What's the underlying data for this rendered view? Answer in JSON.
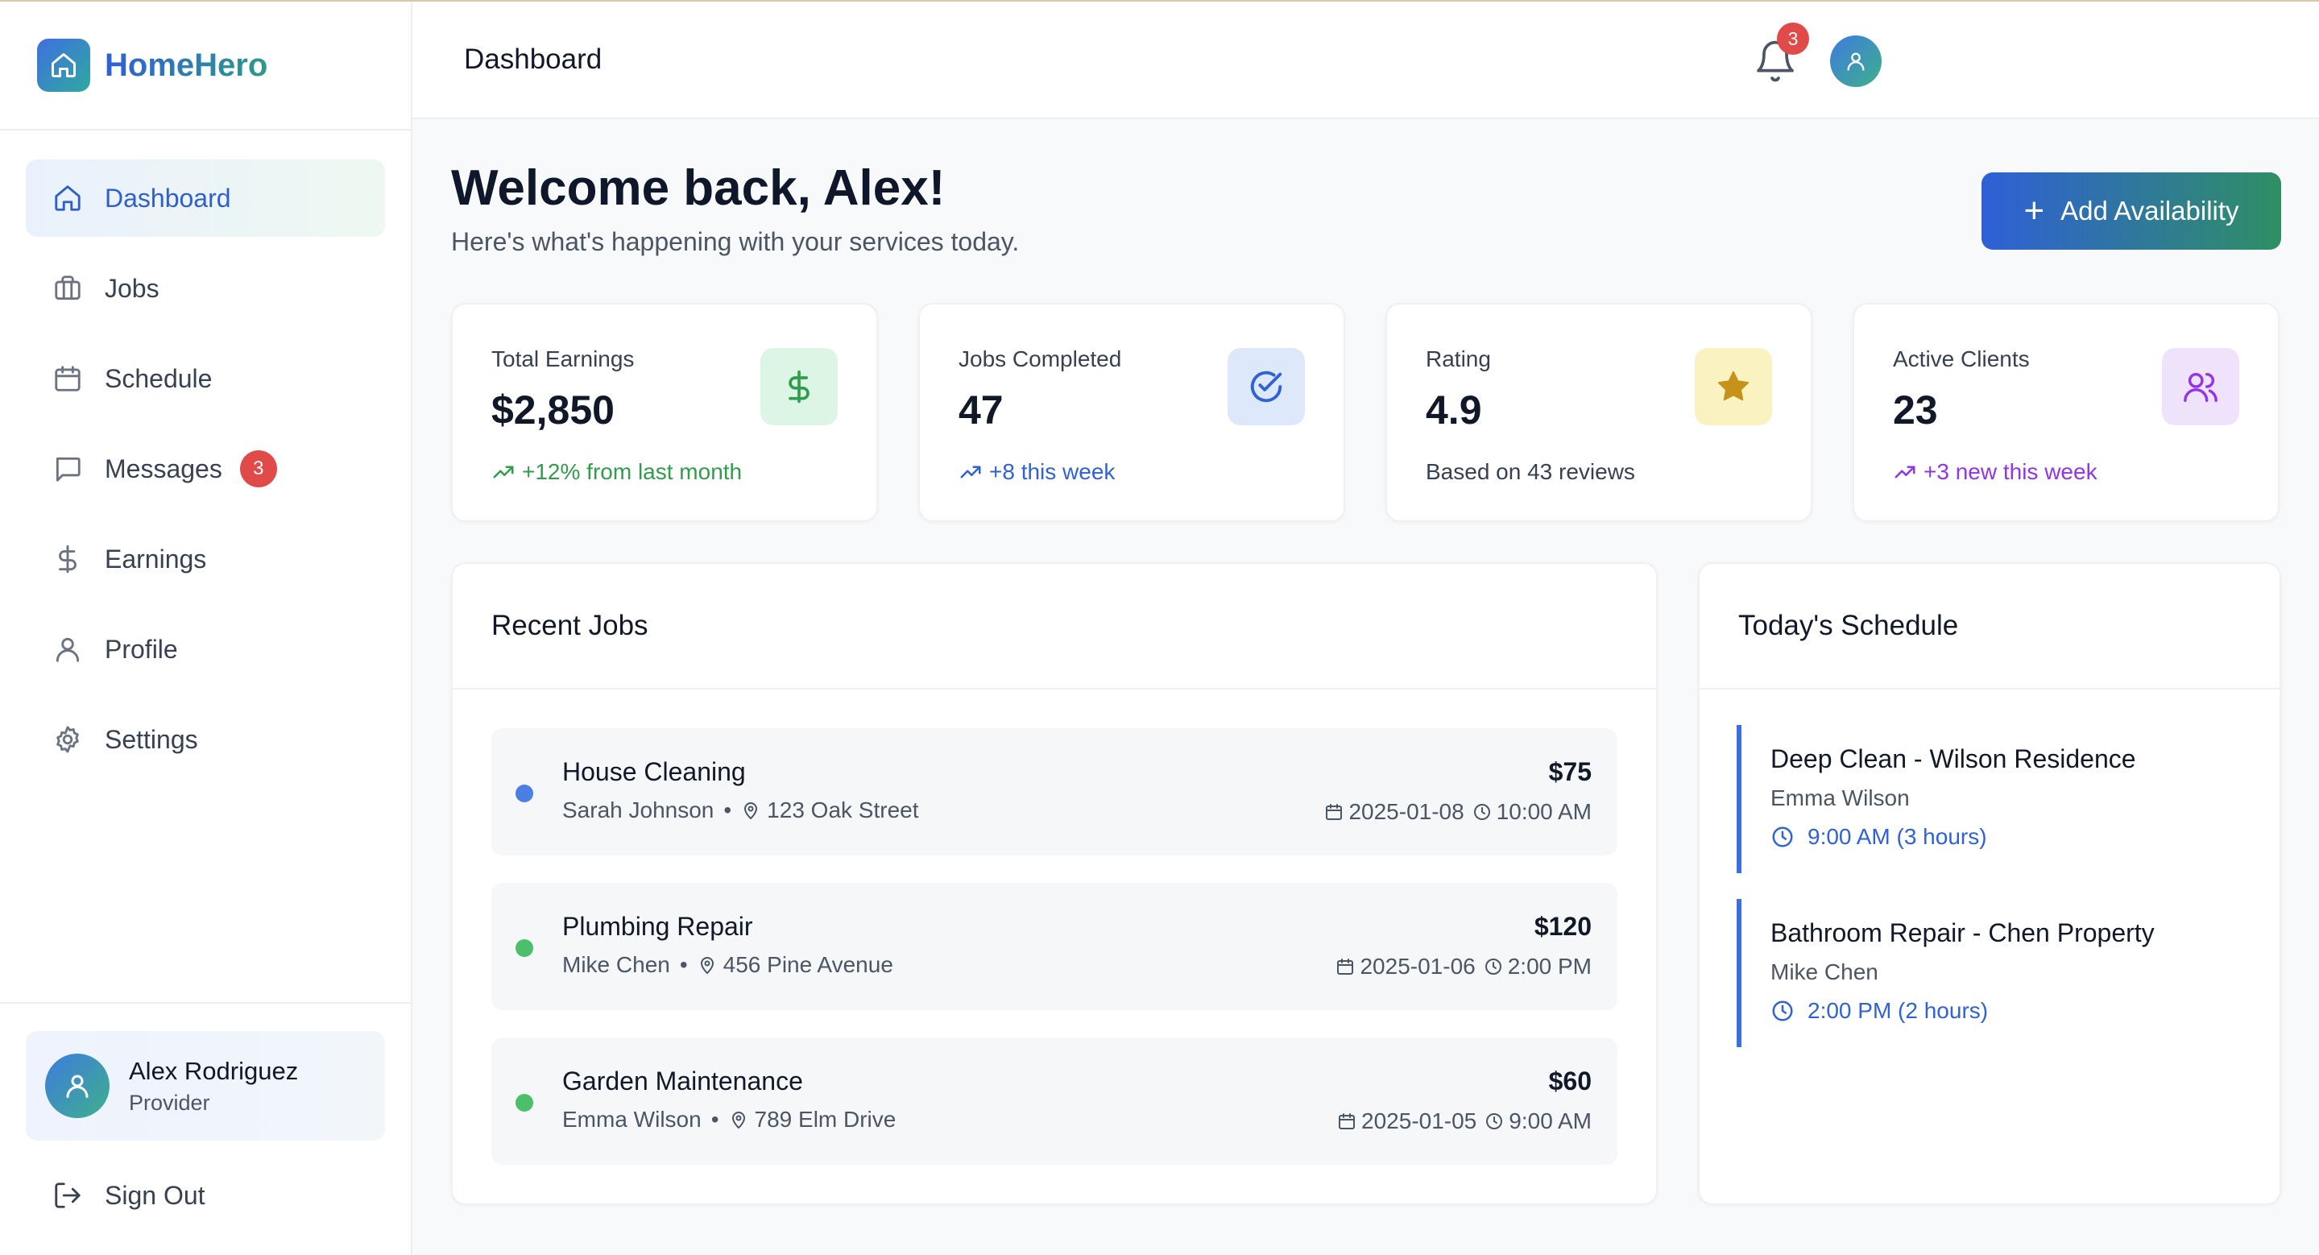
{
  "brand": {
    "name": "HomeHero"
  },
  "sidebar": {
    "items": [
      {
        "label": "Dashboard",
        "icon": "home-icon",
        "active": true
      },
      {
        "label": "Jobs",
        "icon": "briefcase-icon"
      },
      {
        "label": "Schedule",
        "icon": "calendar-icon"
      },
      {
        "label": "Messages",
        "icon": "message-icon",
        "badge": "3"
      },
      {
        "label": "Earnings",
        "icon": "dollar-icon"
      },
      {
        "label": "Profile",
        "icon": "user-icon"
      },
      {
        "label": "Settings",
        "icon": "gear-icon"
      }
    ],
    "user": {
      "name": "Alex Rodriguez",
      "role": "Provider"
    },
    "signout": "Sign Out"
  },
  "header": {
    "title": "Dashboard",
    "notifications": "3"
  },
  "welcome": {
    "title": "Welcome back, Alex!",
    "subtitle": "Here's what's happening with your services today.",
    "add_button": "Add Availability"
  },
  "stats": [
    {
      "label": "Total Earnings",
      "value": "$2,850",
      "trend": "+12% from last month",
      "trend_color": "#2f9e4a",
      "icon": "dollar-icon"
    },
    {
      "label": "Jobs Completed",
      "value": "47",
      "trend": "+8 this week",
      "trend_color": "#2f62d6",
      "icon": "check-circle-icon"
    },
    {
      "label": "Rating",
      "value": "4.9",
      "trend": "Based on 43 reviews",
      "trend_color": "#374151",
      "icon": "star-icon"
    },
    {
      "label": "Active Clients",
      "value": "23",
      "trend": "+3 new this week",
      "trend_color": "#9333ea",
      "icon": "users-icon"
    }
  ],
  "recent_jobs": {
    "title": "Recent Jobs",
    "items": [
      {
        "title": "House Cleaning",
        "client": "Sarah Johnson",
        "address": "123 Oak Street",
        "price": "$75",
        "date": "2025-01-08",
        "time": "10:00 AM",
        "status_color": "#4a7fe6"
      },
      {
        "title": "Plumbing Repair",
        "client": "Mike Chen",
        "address": "456 Pine Avenue",
        "price": "$120",
        "date": "2025-01-06",
        "time": "2:00 PM",
        "status_color": "#4cbf6a"
      },
      {
        "title": "Garden Maintenance",
        "client": "Emma Wilson",
        "address": "789 Elm Drive",
        "price": "$60",
        "date": "2025-01-05",
        "time": "9:00 AM",
        "status_color": "#4cbf6a"
      }
    ]
  },
  "schedule": {
    "title": "Today's Schedule",
    "items": [
      {
        "title": "Deep Clean - Wilson Residence",
        "client": "Emma Wilson",
        "time": "9:00 AM (3 hours)"
      },
      {
        "title": "Bathroom Repair - Chen Property",
        "client": "Mike Chen",
        "time": "2:00 PM (2 hours)"
      }
    ]
  },
  "colors": {
    "accent": "#2f5fcf",
    "badge": "#e04a48"
  }
}
